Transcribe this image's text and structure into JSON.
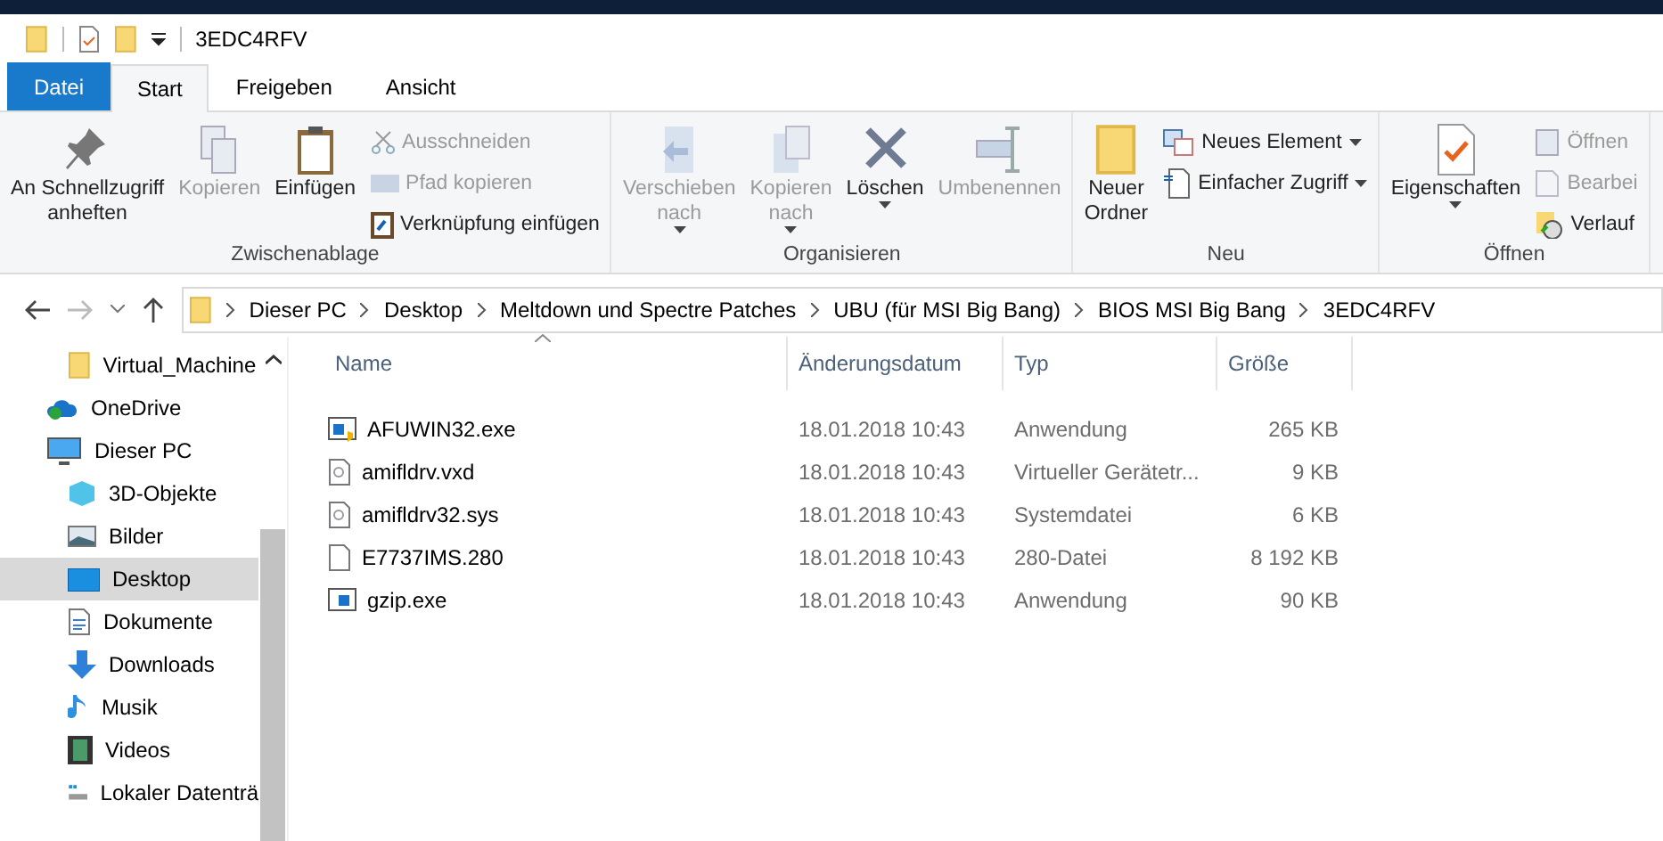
{
  "window": {
    "title": "3EDC4RFV"
  },
  "tabs": [
    {
      "label": "Datei",
      "kind": "file",
      "selected": false
    },
    {
      "label": "Start",
      "kind": "tab",
      "selected": true
    },
    {
      "label": "Freigeben",
      "kind": "tab",
      "selected": false
    },
    {
      "label": "Ansicht",
      "kind": "tab",
      "selected": false
    }
  ],
  "ribbon_groups": [
    {
      "label": "Zwischenablage",
      "items": [
        {
          "kind": "large",
          "label": "An Schnellzugriff\nanheften",
          "disabled": false,
          "dropdown": false
        },
        {
          "kind": "large",
          "label": "Kopieren",
          "disabled": true,
          "dropdown": false
        },
        {
          "kind": "large",
          "label": "Einfügen",
          "disabled": false,
          "dropdown": false
        },
        {
          "kind": "stack",
          "items": [
            {
              "label": "Ausschneiden",
              "disabled": true,
              "dropdown": false
            },
            {
              "label": "Pfad kopieren",
              "disabled": true,
              "dropdown": false
            },
            {
              "label": "Verknüpfung einfügen",
              "disabled": false,
              "dropdown": false
            }
          ]
        }
      ]
    },
    {
      "label": "Organisieren",
      "items": [
        {
          "kind": "large",
          "label": "Verschieben\nnach",
          "disabled": true,
          "dropdown": true
        },
        {
          "kind": "large",
          "label": "Kopieren\nnach",
          "disabled": true,
          "dropdown": true
        },
        {
          "kind": "large",
          "label": "Löschen",
          "disabled": false,
          "dropdown": true
        },
        {
          "kind": "large",
          "label": "Umbenennen",
          "disabled": true,
          "dropdown": false
        }
      ]
    },
    {
      "label": "Neu",
      "items": [
        {
          "kind": "large",
          "label": "Neuer\nOrdner",
          "disabled": false,
          "dropdown": false
        },
        {
          "kind": "stack",
          "items": [
            {
              "label": "Neues Element",
              "disabled": false,
              "dropdown": true
            },
            {
              "label": "Einfacher Zugriff",
              "disabled": false,
              "dropdown": true
            }
          ]
        }
      ]
    },
    {
      "label": "Öffnen",
      "items": [
        {
          "kind": "large",
          "label": "Eigenschaften",
          "disabled": false,
          "dropdown": true
        },
        {
          "kind": "stack",
          "items": [
            {
              "label": "Öffnen",
              "disabled": true,
              "dropdown": false
            },
            {
              "label": "Bearbei",
              "disabled": true,
              "dropdown": false
            },
            {
              "label": "Verlauf",
              "disabled": false,
              "dropdown": false
            }
          ]
        }
      ]
    }
  ],
  "address_bar": {
    "path": [
      "Dieser PC",
      "Desktop",
      "Meltdown und Spectre Patches",
      "UBU (für MSI Big Bang)",
      "BIOS MSI Big Bang",
      "3EDC4RFV"
    ]
  },
  "sidebar": {
    "items": [
      {
        "children": [
          {
            "label": "Virtual_Machine",
            "selected": false
          }
        ]
      },
      {
        "label": "OneDrive",
        "selected": false
      },
      {
        "label": "Dieser PC",
        "selected": false,
        "children": [
          {
            "label": "3D-Objekte",
            "selected": false
          },
          {
            "label": "Bilder",
            "selected": false
          },
          {
            "label": "Desktop",
            "selected": true
          },
          {
            "label": "Dokumente",
            "selected": false
          },
          {
            "label": "Downloads",
            "selected": false
          },
          {
            "label": "Musik",
            "selected": false
          },
          {
            "label": "Videos",
            "selected": false
          },
          {
            "label": "Lokaler Datenträ",
            "selected": false
          }
        ]
      }
    ]
  },
  "table": {
    "columns": [
      "Name",
      "Änderungsdatum",
      "Typ",
      "Größe"
    ],
    "rows": [
      {
        "kind": "exe",
        "cells": [
          "AFUWIN32.exe",
          "18.01.2018 10:43",
          "Anwendung",
          "265 KB"
        ]
      },
      {
        "kind": "system",
        "cells": [
          "amifldrv.vxd",
          "18.01.2018 10:43",
          "Virtueller Gerätetr...",
          "9 KB"
        ]
      },
      {
        "kind": "system",
        "cells": [
          "amifldrv32.sys",
          "18.01.2018 10:43",
          "Systemdatei",
          "6 KB"
        ]
      },
      {
        "kind": "file",
        "cells": [
          "E7737IMS.280",
          "18.01.2018 10:43",
          "280-Datei",
          "8 192 KB"
        ]
      },
      {
        "kind": "app",
        "cells": [
          "gzip.exe",
          "18.01.2018 10:43",
          "Anwendung",
          "90 KB"
        ]
      }
    ]
  }
}
